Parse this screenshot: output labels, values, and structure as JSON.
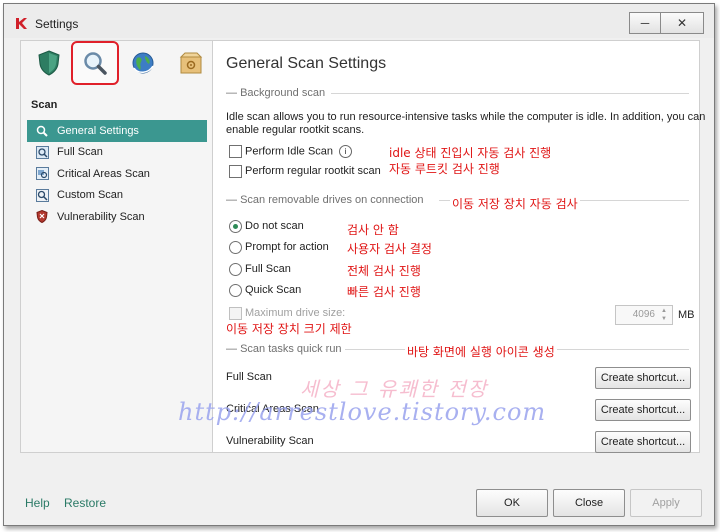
{
  "window": {
    "title": "Settings",
    "minimize": "─",
    "close": "✕"
  },
  "sidebar": {
    "tabs": [
      {
        "name": "protection-tab",
        "icon": "shield-icon"
      },
      {
        "name": "scan-tab",
        "icon": "magnifier-icon",
        "selected": true
      },
      {
        "name": "update-tab",
        "icon": "globe-icon"
      },
      {
        "name": "advanced-tab",
        "icon": "box-icon"
      }
    ],
    "section_title": "Scan",
    "items": [
      {
        "label": "General Settings",
        "icon": "magnifier-icon",
        "active": true
      },
      {
        "label": "Full Scan",
        "icon": "full-scan-icon"
      },
      {
        "label": "Critical Areas Scan",
        "icon": "critical-scan-icon"
      },
      {
        "label": "Custom Scan",
        "icon": "custom-scan-icon"
      },
      {
        "label": "Vulnerability Scan",
        "icon": "vulnerability-shield-icon"
      }
    ]
  },
  "main": {
    "title": "General Scan Settings",
    "background": {
      "group": "Background scan",
      "description_line1": "Idle scan allows you to run resource-intensive tasks while the computer is idle. In addition, you can",
      "description_line2": "enable regular rootkit scans.",
      "perform_idle": "Perform Idle Scan",
      "perform_rootkit": "Perform regular rootkit scan",
      "note_idle": "idle 상태 진입시 자동 검사 진행",
      "note_rootkit": "자동 루트킷 검사 진행"
    },
    "removable": {
      "group": "Scan removable drives on connection",
      "note_group": "이동 저장 장치 자동 검사",
      "options": [
        {
          "label": "Do not scan",
          "selected": true,
          "note": "검사 안 함"
        },
        {
          "label": "Prompt for action",
          "selected": false,
          "note": "사용자 검사 결정"
        },
        {
          "label": "Full Scan",
          "selected": false,
          "note": "전체 검사 진행"
        },
        {
          "label": "Quick Scan",
          "selected": false,
          "note": "빠른 검사 진행"
        }
      ],
      "max_size_label": "Maximum drive size:",
      "max_size_value": "4096",
      "max_size_unit": "MB",
      "note_max": "이동 저장 장치 크기 제한"
    },
    "quickrun": {
      "group": "Scan tasks quick run",
      "note_group": "바탕 화면에 실행 아이콘 생성",
      "tasks": [
        {
          "label": "Full Scan",
          "button": "Create shortcut..."
        },
        {
          "label": "Critical Areas Scan",
          "button": "Create shortcut..."
        },
        {
          "label": "Vulnerability Scan",
          "button": "Create shortcut..."
        }
      ]
    }
  },
  "footer": {
    "help": "Help",
    "restore": "Restore",
    "ok": "OK",
    "close": "Close",
    "apply": "Apply"
  },
  "watermark": {
    "title": "세상 그 유쾌한 전장",
    "url": "http://arrestlove.tistory.com"
  },
  "colors": {
    "accent": "#3b9790",
    "annotation": "#e01515",
    "tab_highlight": "#e0202a"
  }
}
